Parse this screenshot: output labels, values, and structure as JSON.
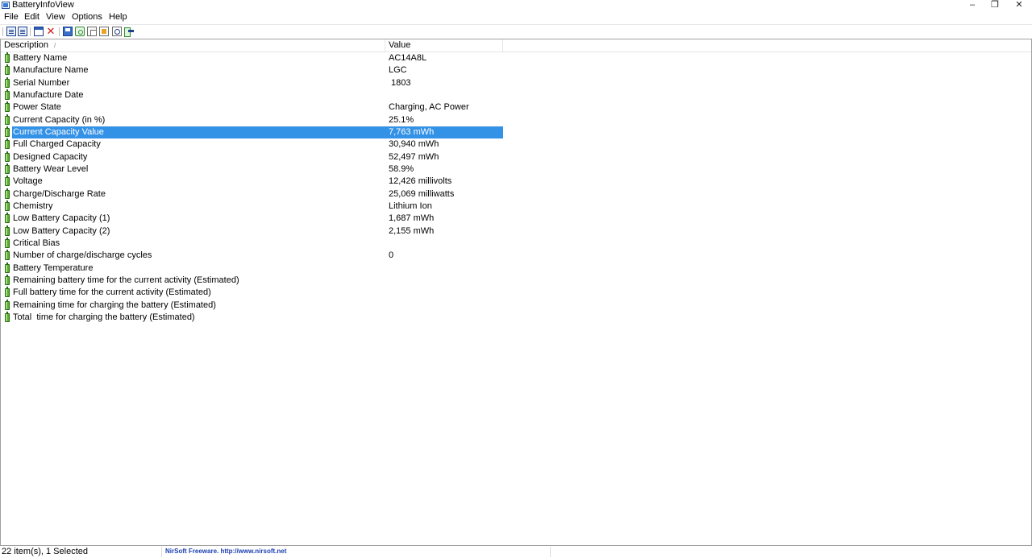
{
  "window": {
    "title": "BatteryInfoView",
    "minimize": "–",
    "maximize": "❐",
    "close": "✕"
  },
  "menu": [
    "File",
    "Edit",
    "View",
    "Options",
    "Help"
  ],
  "toolbar": {
    "icons": [
      "properties-icon",
      "html-report-icon",
      "window-icon",
      "delete-icon",
      "save-icon",
      "refresh-icon",
      "copy-icon",
      "html-icon",
      "find-icon",
      "exit-icon"
    ]
  },
  "columns": {
    "description": "Description",
    "value": "Value",
    "sort_indicator": "/"
  },
  "rows": [
    {
      "desc": "Battery Name",
      "val": "AC14A8L"
    },
    {
      "desc": "Manufacture Name",
      "val": "LGC"
    },
    {
      "desc": "Serial Number",
      "val": " 1803"
    },
    {
      "desc": "Manufacture Date",
      "val": ""
    },
    {
      "desc": "Power State",
      "val": "Charging, AC Power"
    },
    {
      "desc": "Current Capacity (in %)",
      "val": "25.1%"
    },
    {
      "desc": "Current Capacity Value",
      "val": "7,763 mWh",
      "selected": true
    },
    {
      "desc": "Full Charged Capacity",
      "val": "30,940 mWh"
    },
    {
      "desc": "Designed Capacity",
      "val": "52,497 mWh"
    },
    {
      "desc": "Battery Wear Level",
      "val": "58.9%"
    },
    {
      "desc": "Voltage",
      "val": "12,426 millivolts"
    },
    {
      "desc": "Charge/Discharge Rate",
      "val": "25,069 milliwatts"
    },
    {
      "desc": "Chemistry",
      "val": "Lithium Ion"
    },
    {
      "desc": "Low Battery Capacity (1)",
      "val": "1,687 mWh"
    },
    {
      "desc": "Low Battery Capacity (2)",
      "val": "2,155 mWh"
    },
    {
      "desc": "Critical Bias",
      "val": ""
    },
    {
      "desc": "Number of charge/discharge cycles",
      "val": "0"
    },
    {
      "desc": "Battery Temperature",
      "val": ""
    },
    {
      "desc": "Remaining battery time for the current activity (Estimated)",
      "val": ""
    },
    {
      "desc": "Full battery time for the current activity (Estimated)",
      "val": ""
    },
    {
      "desc": "Remaining time for charging the battery (Estimated)",
      "val": ""
    },
    {
      "desc": "Total  time for charging the battery (Estimated)",
      "val": ""
    }
  ],
  "status": {
    "count": "22 item(s), 1 Selected",
    "link": "NirSoft Freeware.  http://www.nirsoft.net"
  },
  "colors": {
    "selection": "#3391e6",
    "battery_icon": "#58b02d",
    "link": "#1c3fb0"
  }
}
